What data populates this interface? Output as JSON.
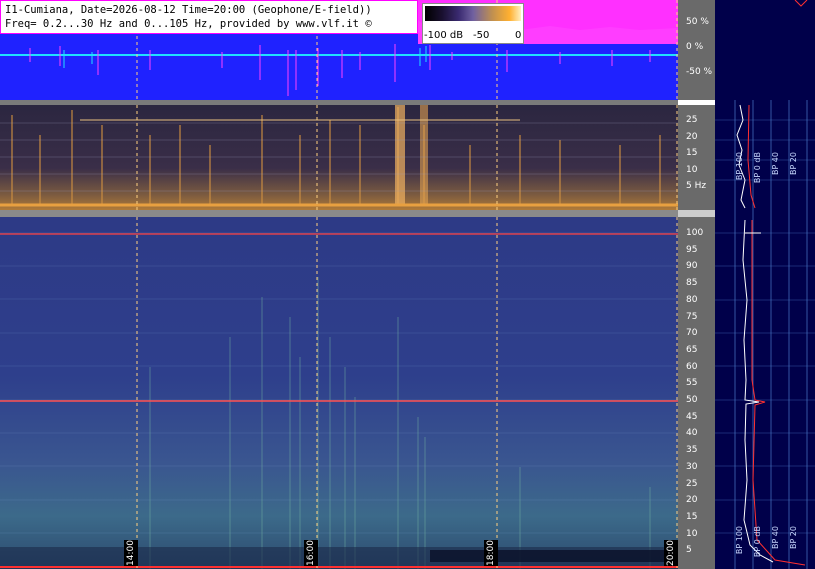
{
  "title_line1": "I1-Cumiana, Date=2026-08-12 Time=20:00 (Geophone/E-field))",
  "title_line2": "Freq= 0.2...30 Hz and 0...105 Hz, provided by www.vlf.it ©",
  "colorbar": {
    "label_min": "-100 dB",
    "label_mid": "-50",
    "label_max": "0"
  },
  "wave_axis": [
    "50 %",
    "0 %",
    "-50 %"
  ],
  "low_freq_axis": [
    "25",
    "20",
    "15",
    "10",
    "5 Hz"
  ],
  "main_freq_axis": [
    "100",
    "95",
    "90",
    "85",
    "80",
    "75",
    "70",
    "65",
    "60",
    "55",
    "50",
    "45",
    "40",
    "35",
    "30",
    "25",
    "20",
    "15",
    "10",
    "5"
  ],
  "time_labels": [
    "14:00",
    "16:00",
    "18:00",
    "20:00"
  ],
  "bp_labels_top": [
    "BP 100",
    "BP 0 dB",
    "BP 40",
    "BP 20"
  ],
  "bp_labels_bottom": [
    "BP 100",
    "BP 0 dB",
    "BP 40",
    "BP 20"
  ],
  "colors": {
    "wave_bg": "#1f22ff",
    "wave_signal": "#ff40ff",
    "wave_center": "#20e0ff",
    "accent_line": "#ff2020",
    "panel_bg": "#00004a"
  }
}
